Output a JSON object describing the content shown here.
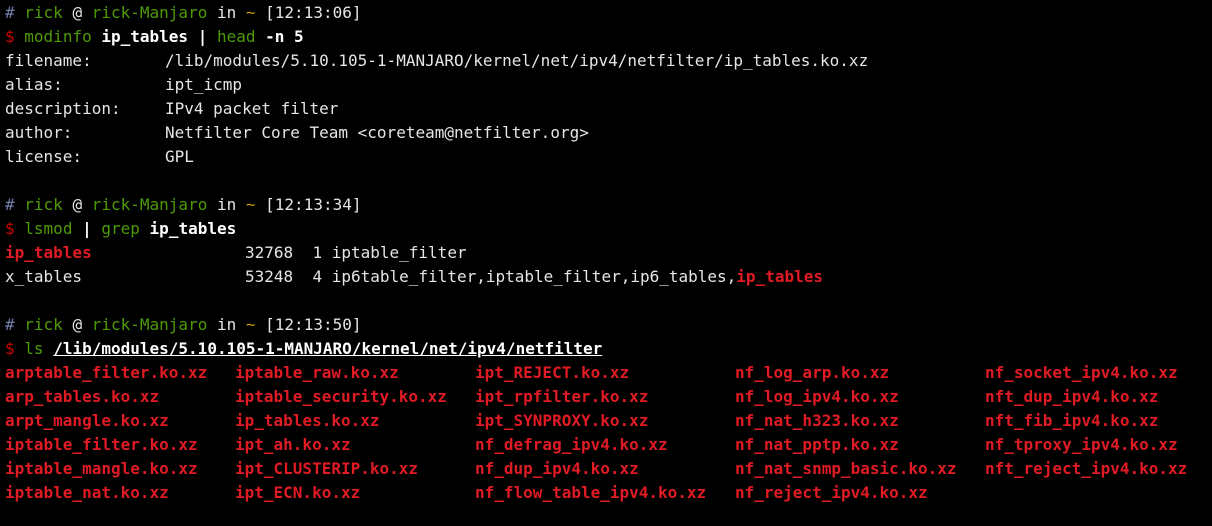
{
  "colors": {
    "background": "#000000",
    "prompt_user": "#4e9a06",
    "tilde": "#c4a000",
    "dollar": "#cc0000",
    "match_red": "#e01b24"
  },
  "block1": {
    "prompt": {
      "hash": "#",
      "user": "rick",
      "at": "@",
      "host": "rick-Manjaro",
      "in": "in",
      "dir": "~",
      "time": "[12:13:06]"
    },
    "cmd": {
      "dollar": "$",
      "name": "modinfo",
      "arg": "ip_tables",
      "pipe": "|",
      "pipe_cmd": "head",
      "flag": "-n 5"
    },
    "output": [
      {
        "key": "filename:",
        "value": "/lib/modules/5.10.105-1-MANJARO/kernel/net/ipv4/netfilter/ip_tables.ko.xz"
      },
      {
        "key": "alias:",
        "value": "ipt_icmp"
      },
      {
        "key": "description:",
        "value": "IPv4 packet filter"
      },
      {
        "key": "author:",
        "value": "Netfilter Core Team <coreteam@netfilter.org>"
      },
      {
        "key": "license:",
        "value": "GPL"
      }
    ]
  },
  "block2": {
    "prompt": {
      "hash": "#",
      "user": "rick",
      "at": "@",
      "host": "rick-Manjaro",
      "in": "in",
      "dir": "~",
      "time": "[12:13:34]"
    },
    "cmd": {
      "dollar": "$",
      "name": "lsmod",
      "pipe": "|",
      "pipe_cmd": "grep",
      "arg": "ip_tables"
    },
    "rows": [
      {
        "module": "ip_tables",
        "size": "32768",
        "used": "1",
        "by": "iptable_filter",
        "by_match": ""
      },
      {
        "module": "x_tables",
        "size": "53248",
        "used": "4",
        "by": "ip6table_filter,iptable_filter,ip6_tables,",
        "by_match": "ip_tables"
      }
    ]
  },
  "block3": {
    "prompt": {
      "hash": "#",
      "user": "rick",
      "at": "@",
      "host": "rick-Manjaro",
      "in": "in",
      "dir": "~",
      "time": "[12:13:50]"
    },
    "cmd": {
      "dollar": "$",
      "name": "ls",
      "arg": "/lib/modules/5.10.105-1-MANJARO/kernel/net/ipv4/netfilter"
    },
    "columns": [
      [
        "arptable_filter.ko.xz",
        "arp_tables.ko.xz",
        "arpt_mangle.ko.xz",
        "iptable_filter.ko.xz",
        "iptable_mangle.ko.xz",
        "iptable_nat.ko.xz"
      ],
      [
        "iptable_raw.ko.xz",
        "iptable_security.ko.xz",
        "ip_tables.ko.xz",
        "ipt_ah.ko.xz",
        "ipt_CLUSTERIP.ko.xz",
        "ipt_ECN.ko.xz"
      ],
      [
        "ipt_REJECT.ko.xz",
        "ipt_rpfilter.ko.xz",
        "ipt_SYNPROXY.ko.xz",
        "nf_defrag_ipv4.ko.xz",
        "nf_dup_ipv4.ko.xz",
        "nf_flow_table_ipv4.ko.xz"
      ],
      [
        "nf_log_arp.ko.xz",
        "nf_log_ipv4.ko.xz",
        "nf_nat_h323.ko.xz",
        "nf_nat_pptp.ko.xz",
        "nf_nat_snmp_basic.ko.xz",
        "nf_reject_ipv4.ko.xz"
      ],
      [
        "nf_socket_ipv4.ko.xz",
        "nft_dup_ipv4.ko.xz",
        "nft_fib_ipv4.ko.xz",
        "nf_tproxy_ipv4.ko.xz",
        "nft_reject_ipv4.ko.xz"
      ]
    ]
  }
}
